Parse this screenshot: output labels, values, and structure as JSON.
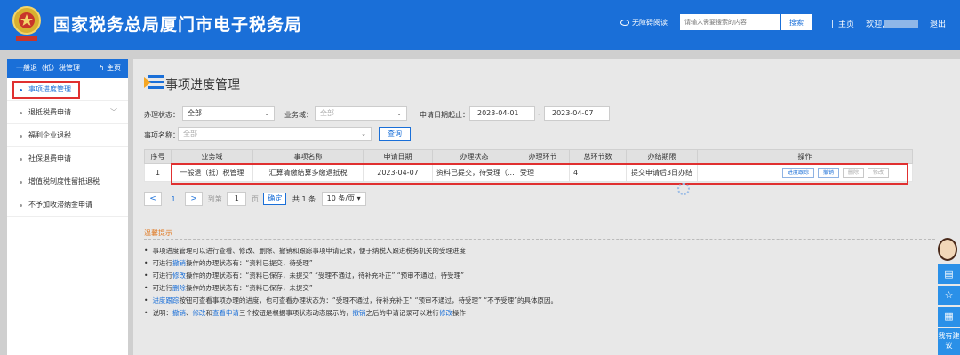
{
  "header": {
    "title": "国家税务总局厦门市电子税务局",
    "accessibility": "无障碍阅读",
    "search_placeholder": "请输入需要搜索的内容",
    "search_button": "搜索",
    "home": "主页",
    "welcome": "欢迎,",
    "logout": "退出"
  },
  "sidebar": {
    "head": "一般退（抵）税管理",
    "home_link": "主页",
    "items": [
      {
        "label": "事项进度管理"
      },
      {
        "label": "退抵税费申请"
      },
      {
        "label": "福利企业退税"
      },
      {
        "label": "社保退费申请"
      },
      {
        "label": "增值税制度性留抵退税"
      },
      {
        "label": "不予加收滞纳金申请"
      }
    ]
  },
  "main": {
    "title": "事项进度管理",
    "filters": {
      "status_label": "办理状态：",
      "status_value": "全部",
      "domain_label": "业务域：",
      "domain_value": "全部",
      "date_label": "申请日期起止：",
      "date_from": "2023-04-01",
      "date_sep": "-",
      "date_to": "2023-04-07",
      "item_label": "事项名称：",
      "item_value": "全部",
      "query_button": "查询"
    },
    "table": {
      "headers": [
        "序号",
        "业务域",
        "事项名称",
        "申请日期",
        "办理状态",
        "办理环节",
        "总环节数",
        "办结期限",
        "操作"
      ],
      "rows": [
        {
          "no": "1",
          "domain": "一般退（抵）税管理",
          "item": "汇算清缴结算多缴退抵税",
          "date": "2023-04-07",
          "status": "资料已提交，待受理（...",
          "step": "受理",
          "total": "4",
          "deadline": "提交申请后3日办结",
          "ops": [
            "进度跟踪",
            "撤销",
            "删除",
            "修改"
          ]
        }
      ]
    },
    "pager": {
      "prev": "<",
      "page": "1",
      "next": ">",
      "goto": "到第",
      "goto_value": "1",
      "page_unit": "页",
      "ok": "确定",
      "total": "共 1 条",
      "size": "10 条/页"
    },
    "tips": {
      "head": "温馨提示",
      "lines": [
        {
          "parts": [
            {
              "t": "事项进度管理可以进行查看、修改、删除、撤销和跟踪事项申请记录，便于纳税人跟进税务机关的受理进度"
            }
          ]
        },
        {
          "parts": [
            {
              "t": "可进行"
            },
            {
              "t": "撤销",
              "hl": true
            },
            {
              "t": "操作的办理状态有：“资料已提交，待受理”"
            }
          ]
        },
        {
          "parts": [
            {
              "t": "可进行"
            },
            {
              "t": "修改",
              "hl": true
            },
            {
              "t": "操作的办理状态有：“资料已保存，未提交”   “受理不通过，待补充补正”   “预审不通过，待受理”"
            }
          ]
        },
        {
          "parts": [
            {
              "t": "可进行"
            },
            {
              "t": "删除",
              "hl": true
            },
            {
              "t": "操作的办理状态有：“资料已保存，未提交”"
            }
          ]
        },
        {
          "parts": [
            {
              "t": "进度跟踪",
              "hl": true
            },
            {
              "t": "按钮可查看事项办理的进度，也可查看办理状态为：“受理不通过，待补充补正”   “预审不通过，待受理”   “不予受理”的具体原因。"
            }
          ]
        },
        {
          "parts": [
            {
              "t": "说明："
            },
            {
              "t": "撤销",
              "hl": true
            },
            {
              "t": "、"
            },
            {
              "t": "修改",
              "hl": true
            },
            {
              "t": "和"
            },
            {
              "t": "查看申请",
              "hl": true
            },
            {
              "t": "三个按钮是根据事项状态动态展示的，"
            },
            {
              "t": "撤销",
              "hl": true
            },
            {
              "t": "之后的申请记录可以进行"
            },
            {
              "t": "修改",
              "hl": true
            },
            {
              "t": "操作"
            }
          ]
        }
      ]
    }
  },
  "float_tools": {
    "suggest": "我有建议"
  }
}
